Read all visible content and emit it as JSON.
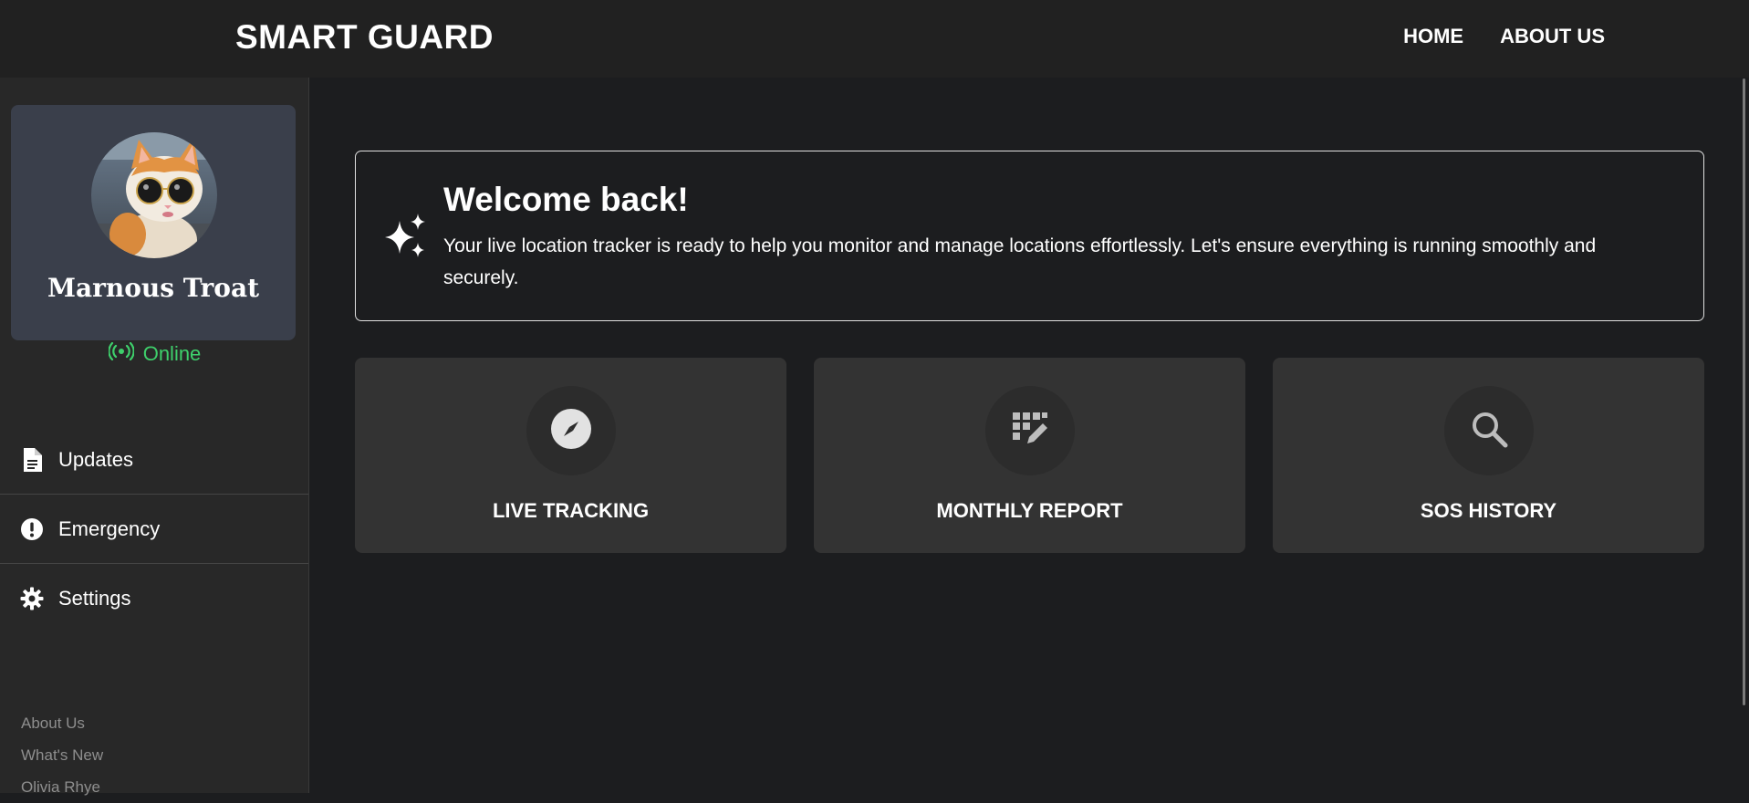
{
  "header": {
    "brand": "SMART GUARD",
    "nav": [
      {
        "label": "HOME"
      },
      {
        "label": "ABOUT US"
      }
    ]
  },
  "sidebar": {
    "profile": {
      "name": "Marnous Troat",
      "avatar_icon": "cat-with-sunglasses-avatar"
    },
    "status": {
      "label": "Online",
      "icon": "broadcast-signal-icon",
      "color": "#3ecf6b"
    },
    "menu": [
      {
        "label": "Updates",
        "icon": "document-icon"
      },
      {
        "label": "Emergency",
        "icon": "alert-circle-icon"
      },
      {
        "label": "Settings",
        "icon": "gear-icon"
      }
    ],
    "footer_links": [
      {
        "label": "About Us"
      },
      {
        "label": "What's New"
      },
      {
        "label": "Olivia Rhye"
      }
    ]
  },
  "welcome": {
    "title": "Welcome back!",
    "message": "Your live location tracker is ready to help you monitor and manage locations effortlessly. Let's ensure everything is running smoothly and securely.",
    "icon": "sparkles-icon"
  },
  "cards": [
    {
      "label": "LIVE TRACKING",
      "icon": "compass-icon"
    },
    {
      "label": "MONTHLY REPORT",
      "icon": "grid-edit-icon"
    },
    {
      "label": "SOS HISTORY",
      "icon": "search-icon"
    }
  ]
}
